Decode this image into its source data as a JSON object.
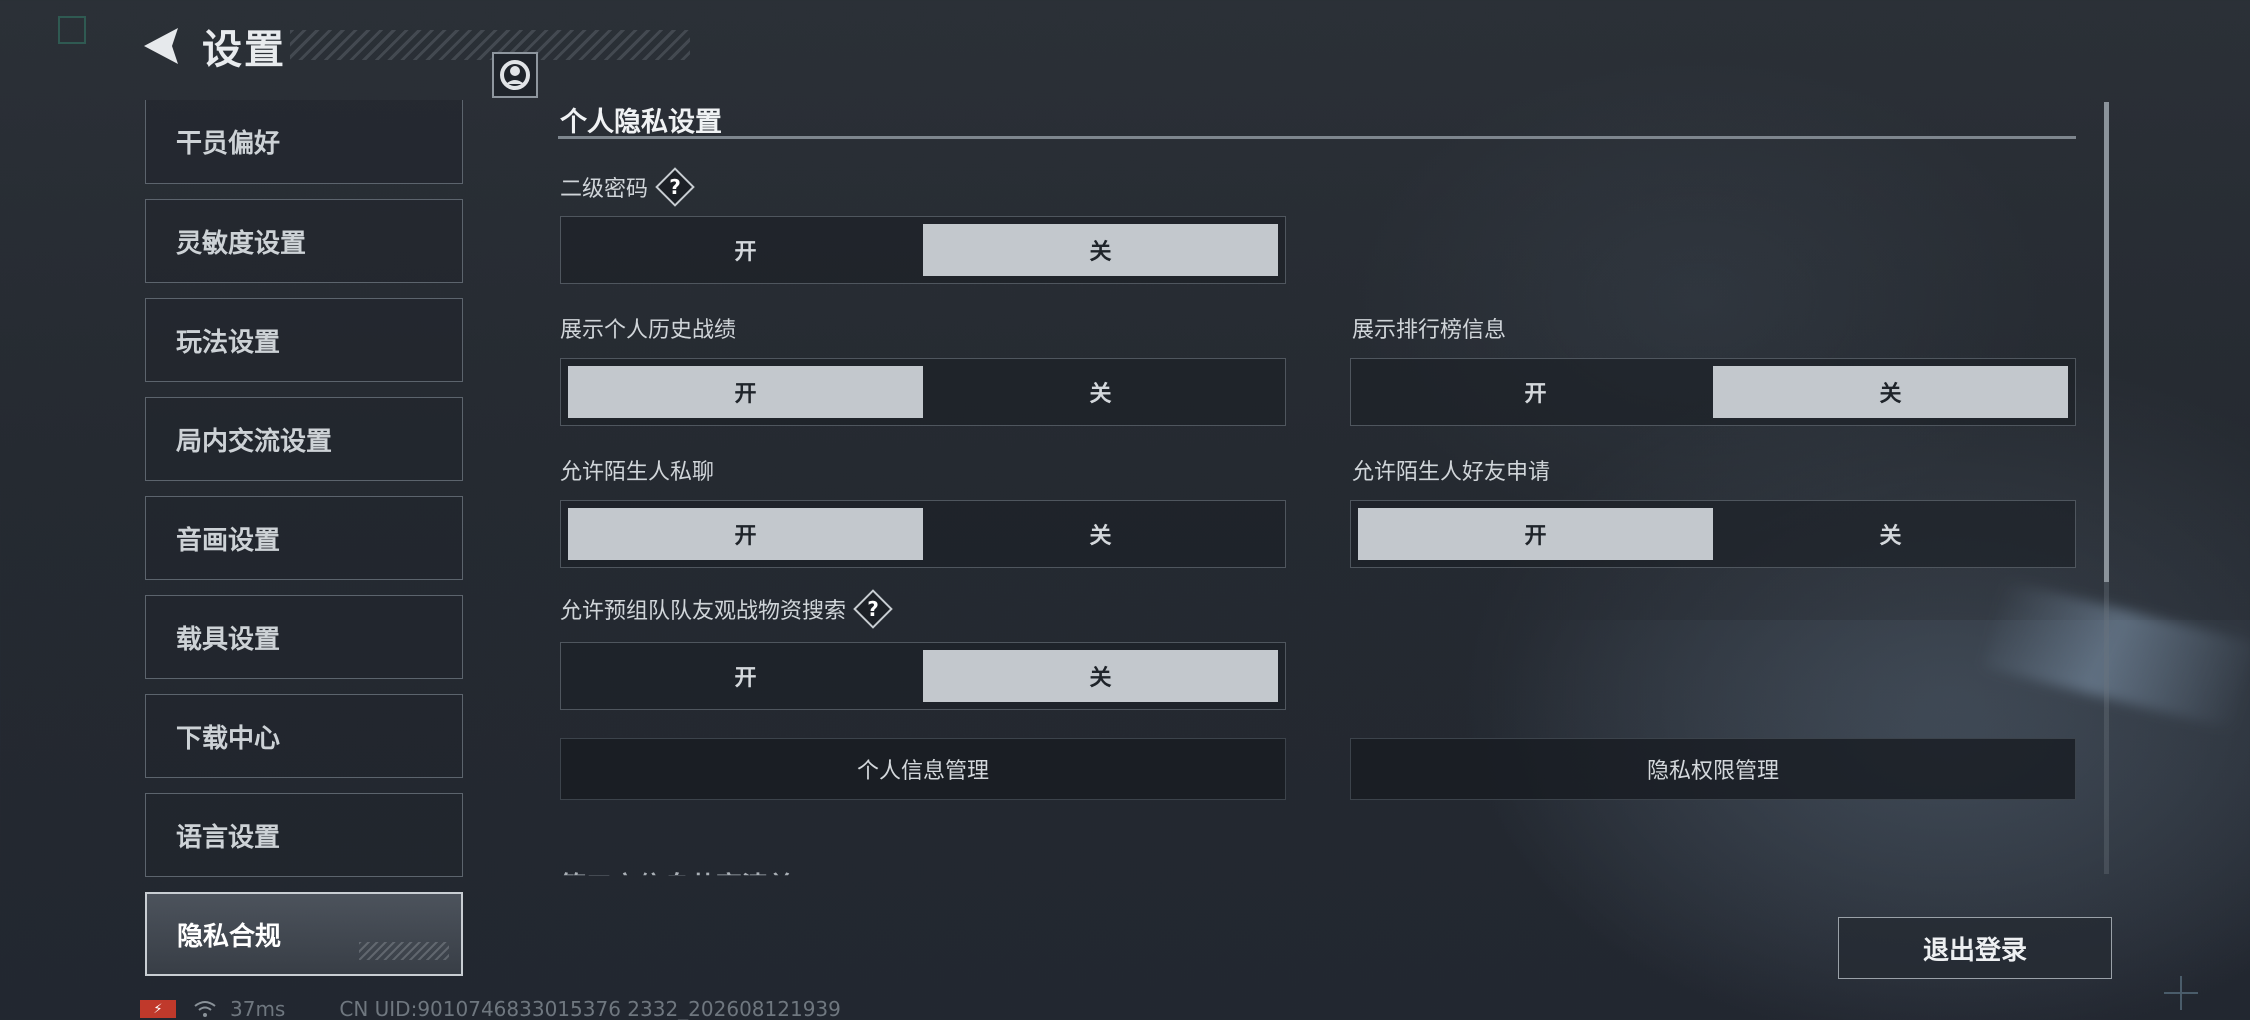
{
  "header": {
    "title": "设置",
    "back_icon": "back-arrow-icon",
    "logo_icon": "game-logo-icon"
  },
  "sidebar": {
    "items": [
      {
        "label": "干员偏好"
      },
      {
        "label": "灵敏度设置"
      },
      {
        "label": "玩法设置"
      },
      {
        "label": "局内交流设置"
      },
      {
        "label": "音画设置"
      },
      {
        "label": "载具设置"
      },
      {
        "label": "下载中心"
      },
      {
        "label": "语言设置"
      },
      {
        "label": "隐私合规"
      }
    ],
    "active": "隐私合规"
  },
  "privacy": {
    "section_title": "个人隐私设置",
    "help_glyph": "?",
    "settings": [
      {
        "label": "二级密码",
        "on_label": "开",
        "off_label": "关",
        "value": "关",
        "has_help": true
      },
      {
        "label": "展示个人历史战绩",
        "on_label": "开",
        "off_label": "关",
        "value": "开"
      },
      {
        "label": "展示排行榜信息",
        "on_label": "开",
        "off_label": "关",
        "value": "关"
      },
      {
        "label": "允许陌生人私聊",
        "on_label": "开",
        "off_label": "关",
        "value": "开"
      },
      {
        "label": "允许陌生人好友申请",
        "on_label": "开",
        "off_label": "关",
        "value": "开"
      },
      {
        "label": "允许预组队队友观战物资搜索",
        "on_label": "开",
        "off_label": "关",
        "value": "关",
        "has_help": true
      }
    ],
    "buttons": {
      "personal_info": "个人信息管理",
      "privacy_permissions": "隐私权限管理"
    },
    "next_section_title": "第三方信息共享清单"
  },
  "logout_label": "退出登录",
  "status": {
    "battery_icon": "battery-charging-icon",
    "battery_glyph": "⚡",
    "wifi_icon": "wifi-icon",
    "ping": "37ms",
    "uid": "CN UID:9010746833015376 2332_202608121939"
  },
  "colors": {
    "selected": "#c3c8cd",
    "background": "#252a31",
    "battery": "#c0392b"
  }
}
